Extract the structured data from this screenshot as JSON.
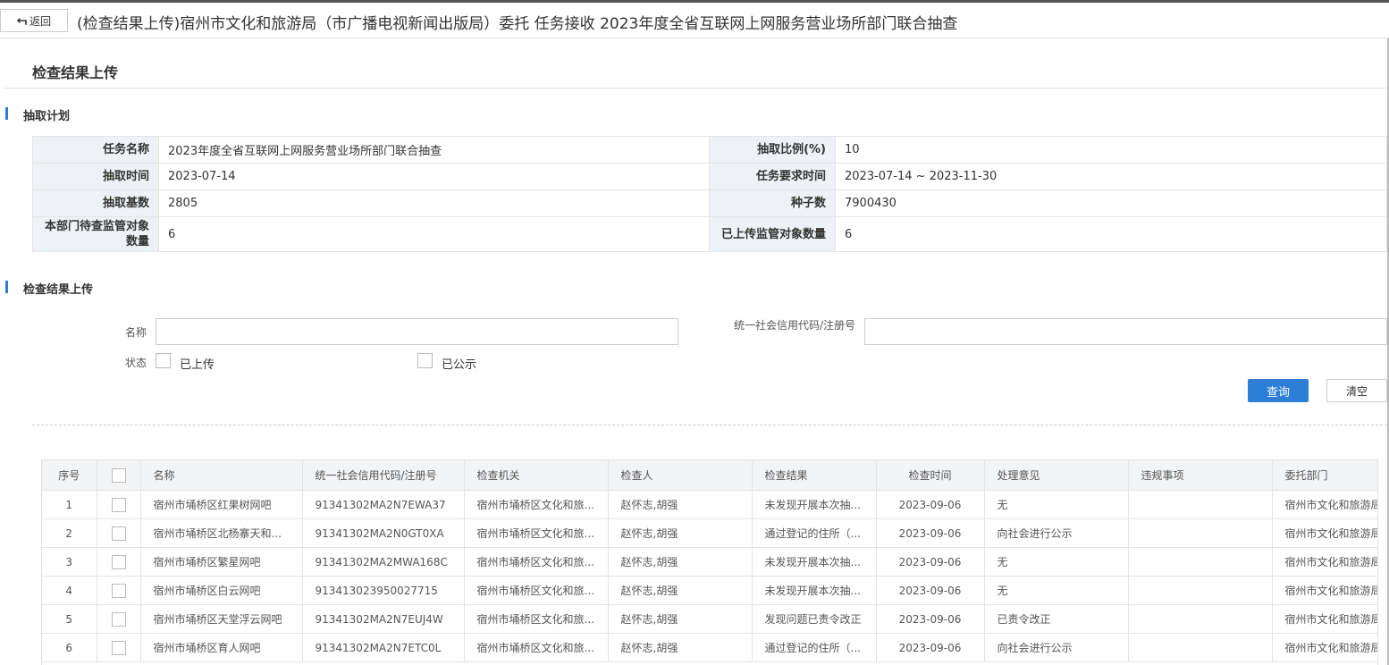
{
  "topbar": {
    "back_label": "返回",
    "title": "(检查结果上传)宿州市文化和旅游局（市广播电视新闻出版局）委托 任务接收 2023年度全省互联网上网服务营业场所部门联合抽查"
  },
  "page_title": "检查结果上传",
  "plan_section": {
    "heading": "抽取计划",
    "rows": [
      [
        {
          "label": "任务名称",
          "value": "2023年度全省互联网上网服务营业场所部门联合抽查"
        },
        {
          "label": "抽取比例(%)",
          "value": "10"
        }
      ],
      [
        {
          "label": "抽取时间",
          "value": "2023-07-14"
        },
        {
          "label": "任务要求时间",
          "value": "2023-07-14 ~ 2023-11-30"
        }
      ],
      [
        {
          "label": "抽取基数",
          "value": "2805"
        },
        {
          "label": "种子数",
          "value": "7900430"
        }
      ],
      [
        {
          "label": "本部门待查监管对象数量",
          "value": "6"
        },
        {
          "label": "已上传监管对象数量",
          "value": "6"
        }
      ]
    ]
  },
  "upload_section": {
    "heading": "检查结果上传",
    "name_label": "名称",
    "name_value": "",
    "credit_label": "统一社会信用代码/注册号",
    "credit_value": "",
    "status_label": "状态",
    "status_options": [
      "已上传",
      "已公示"
    ],
    "search_button": "查询",
    "clear_button": "清空"
  },
  "table": {
    "columns": [
      "序号",
      "",
      "名称",
      "统一社会信用代码/注册号",
      "检查机关",
      "检查人",
      "检查结果",
      "检查时间",
      "处理意见",
      "违规事项",
      "委托部门"
    ],
    "rows": [
      [
        "1",
        "",
        "宿州市埇桥区红果树网吧",
        "91341302MA2N7EWA37",
        "宿州市埇桥区文化和旅...",
        "赵怀志,胡强",
        "未发现开展本次抽...",
        "2023-09-06",
        "无",
        "",
        "宿州市文化和旅游局"
      ],
      [
        "2",
        "",
        "宿州市埇桥区北杨寨天和...",
        "91341302MA2N0GT0XA",
        "宿州市埇桥区文化和旅...",
        "赵怀志,胡强",
        "通过登记的住所（...",
        "2023-09-06",
        "向社会进行公示",
        "",
        "宿州市文化和旅游局"
      ],
      [
        "3",
        "",
        "宿州市埇桥区繁星网吧",
        "91341302MA2MWA168C",
        "宿州市埇桥区文化和旅...",
        "赵怀志,胡强",
        "未发现开展本次抽...",
        "2023-09-06",
        "无",
        "",
        "宿州市文化和旅游局"
      ],
      [
        "4",
        "",
        "宿州市埇桥区白云网吧",
        "913413023950027715",
        "宿州市埇桥区文化和旅...",
        "赵怀志,胡强",
        "未发现开展本次抽...",
        "2023-09-06",
        "无",
        "",
        "宿州市文化和旅游局"
      ],
      [
        "5",
        "",
        "宿州市埇桥区天堂浮云网吧",
        "91341302MA2N7EUJ4W",
        "宿州市埇桥区文化和旅...",
        "赵怀志,胡强",
        "发现问题已责令改正",
        "2023-09-06",
        "已责令改正",
        "",
        "宿州市文化和旅游局"
      ],
      [
        "6",
        "",
        "宿州市埇桥区育人网吧",
        "91341302MA2N7ETC0L",
        "宿州市埇桥区文化和旅...",
        "赵怀志,胡强",
        "通过登记的住所（...",
        "2023-09-06",
        "向社会进行公示",
        "",
        "宿州市文化和旅游局"
      ]
    ]
  }
}
